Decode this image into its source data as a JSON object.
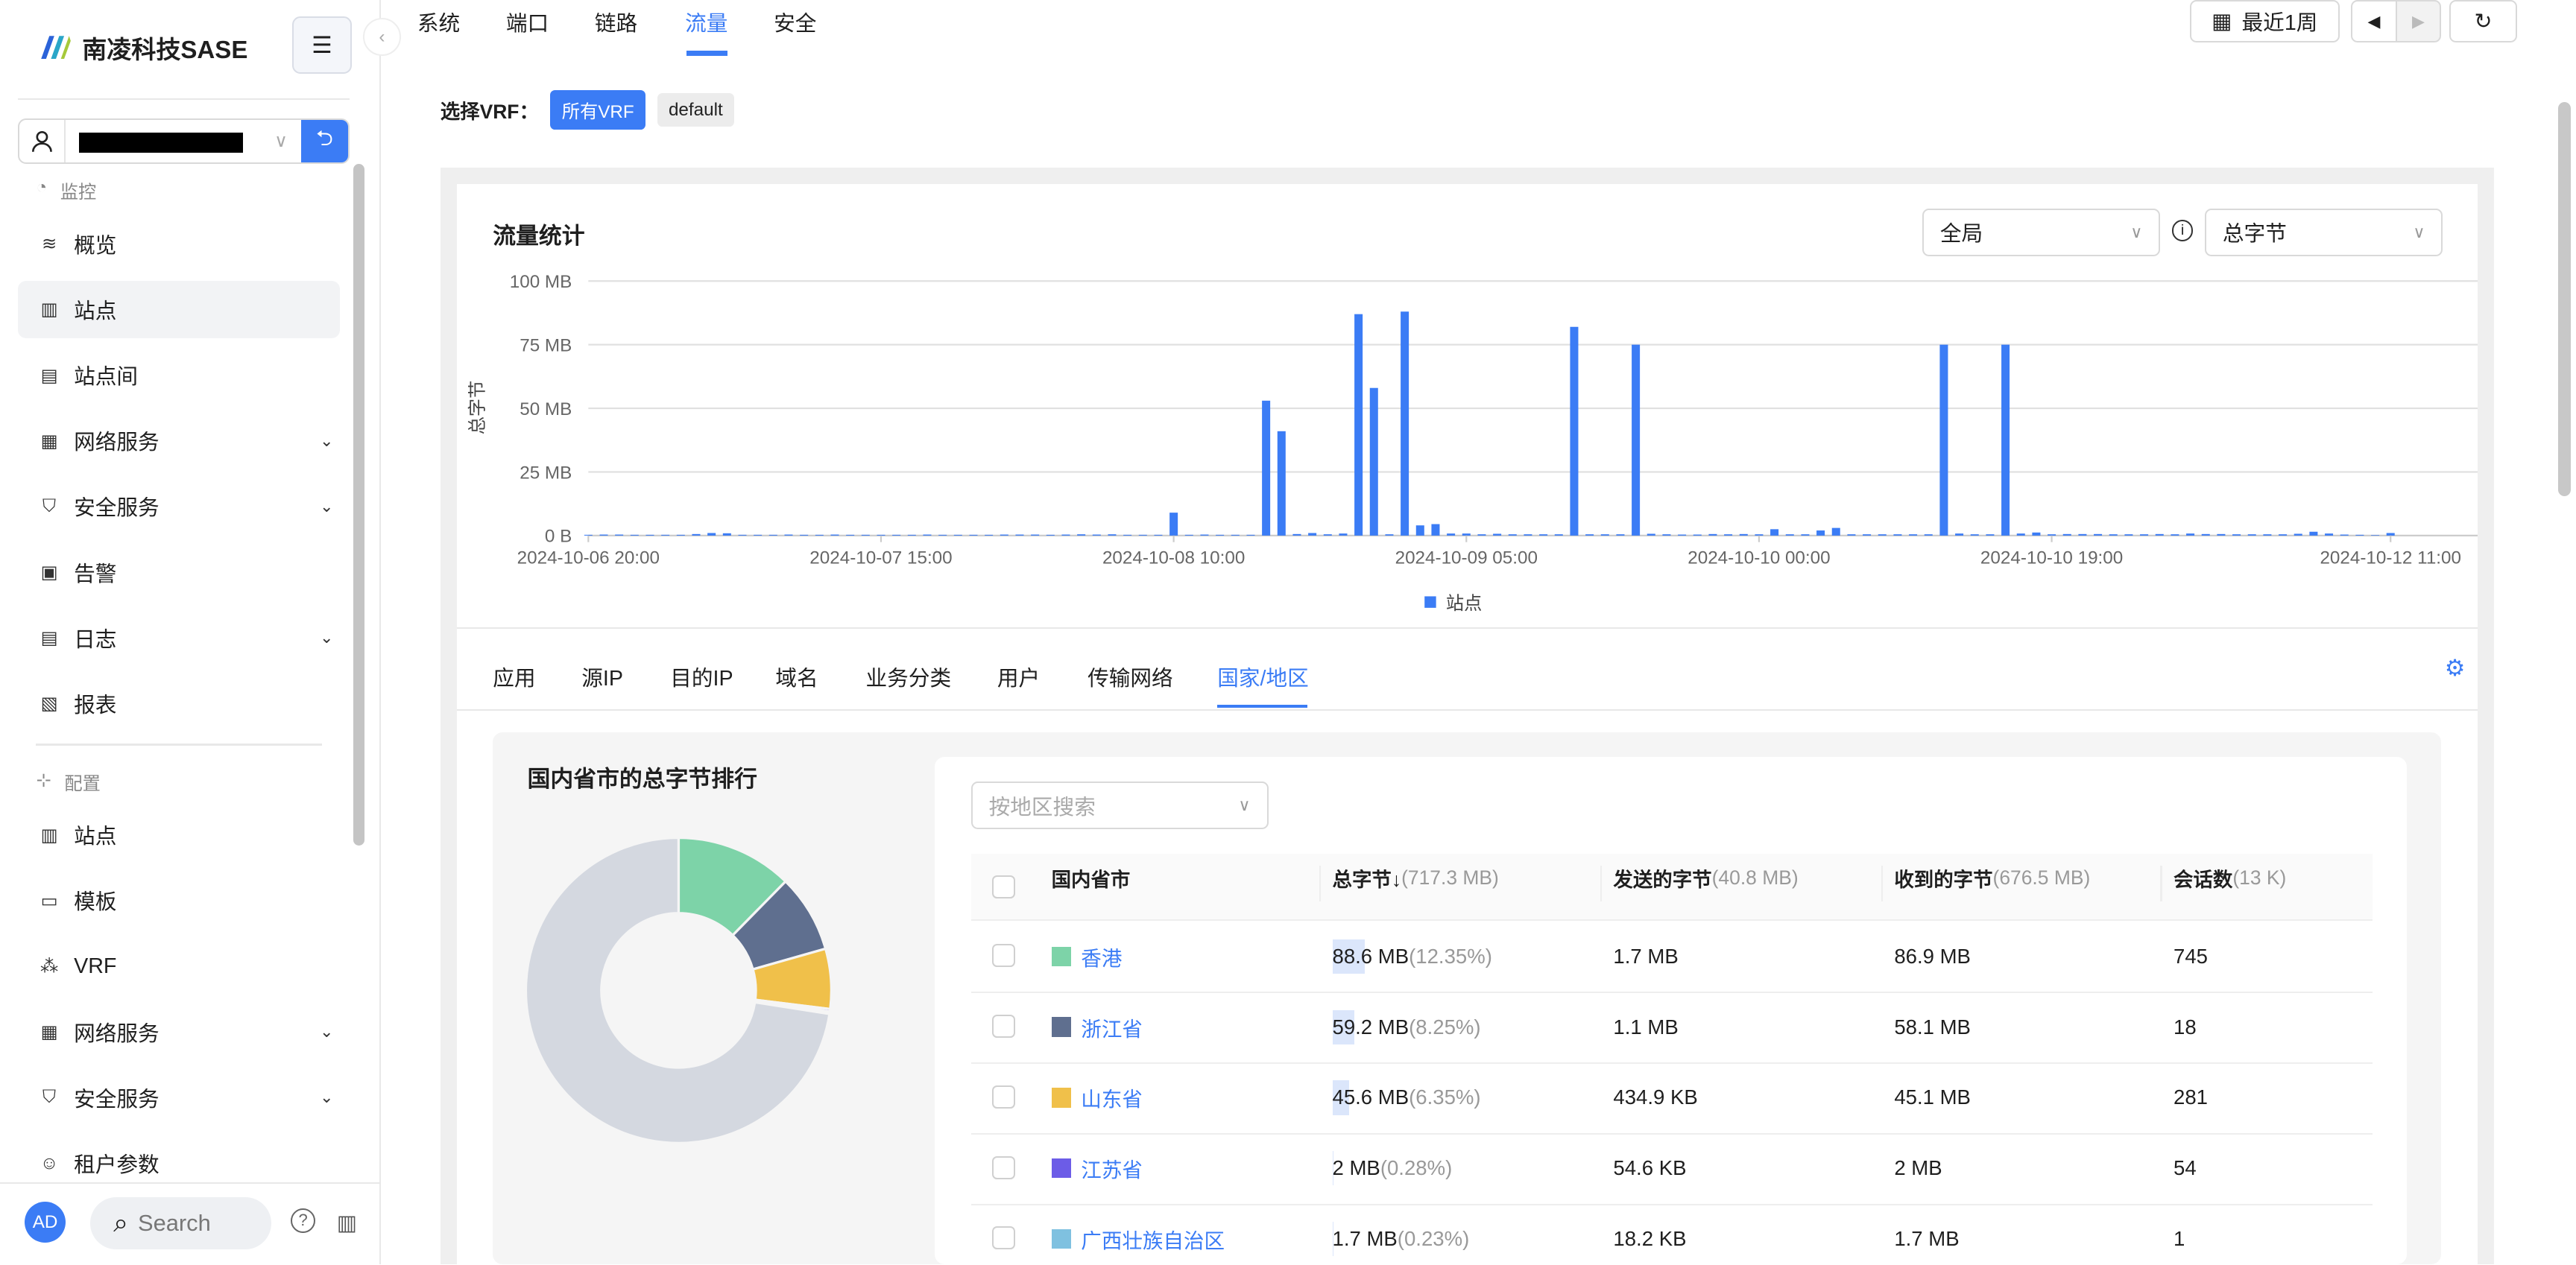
{
  "brand": {
    "name": "南凌科技SASE"
  },
  "sidebar": {
    "user_value": "",
    "sections": [
      {
        "label": "监控"
      },
      {
        "label": "配置"
      }
    ],
    "monitor_items": [
      {
        "label": "概览",
        "icon": "wave-icon"
      },
      {
        "label": "站点",
        "icon": "building-icon",
        "selected": true
      },
      {
        "label": "站点间",
        "icon": "sites-icon"
      },
      {
        "label": "网络服务",
        "icon": "network-icon",
        "expandable": true
      },
      {
        "label": "安全服务",
        "icon": "shield-icon",
        "expandable": true
      },
      {
        "label": "告警",
        "icon": "alert-icon"
      },
      {
        "label": "日志",
        "icon": "log-icon",
        "expandable": true
      },
      {
        "label": "报表",
        "icon": "report-icon"
      }
    ],
    "config_items": [
      {
        "label": "站点",
        "icon": "building-icon"
      },
      {
        "label": "模板",
        "icon": "template-icon"
      },
      {
        "label": "VRF",
        "icon": "vrf-icon"
      },
      {
        "label": "网络服务",
        "icon": "network-icon",
        "expandable": true
      },
      {
        "label": "安全服务",
        "icon": "shield-icon",
        "expandable": true
      },
      {
        "label": "租户参数",
        "icon": "tenant-icon"
      }
    ],
    "avatar": "AD",
    "search_placeholder": "Search"
  },
  "top_tabs": [
    {
      "label": "系统"
    },
    {
      "label": "端口"
    },
    {
      "label": "链路"
    },
    {
      "label": "流量",
      "active": true
    },
    {
      "label": "安全"
    }
  ],
  "toolbar": {
    "range_label": "最近1周"
  },
  "vrf": {
    "label": "选择VRF：",
    "options": [
      {
        "label": "所有VRF",
        "active": true
      },
      {
        "label": "default"
      }
    ]
  },
  "chart_panel": {
    "title": "流量统计",
    "scope_select": "全局",
    "metric_select": "总字节"
  },
  "chart_data": {
    "type": "bar",
    "ylabel": "总字节",
    "ylim": [
      0,
      100
    ],
    "y_unit": "MB",
    "y_ticks": [
      "0 B",
      "25 MB",
      "50 MB",
      "75 MB",
      "100 MB"
    ],
    "x_ticks": [
      {
        "label": "2024-10-06 20:00",
        "index": 0
      },
      {
        "label": "2024-10-07 15:00",
        "index": 19
      },
      {
        "label": "2024-10-08 10:00",
        "index": 38
      },
      {
        "label": "2024-10-09 05:00",
        "index": 57
      },
      {
        "label": "2024-10-10 00:00",
        "index": 76
      },
      {
        "label": "2024-10-10 19:00",
        "index": 95
      },
      {
        "label": "2024-10-12 11:00",
        "index": 117
      }
    ],
    "series": [
      {
        "name": "站点",
        "color": "#3b7cf5",
        "values": [
          0.3,
          0.4,
          0.4,
          0.3,
          0.3,
          0.3,
          0.3,
          0.6,
          1.0,
          0.9,
          0.3,
          0.3,
          0.3,
          0.4,
          0.3,
          0.3,
          0.4,
          0.3,
          0.3,
          0.3,
          0.3,
          0.3,
          0.4,
          0.3,
          0.3,
          0.3,
          0.3,
          0.4,
          0.4,
          0.4,
          0.3,
          0.4,
          0.5,
          0.4,
          0.5,
          0.3,
          0.3,
          0.3,
          9,
          0.3,
          0.4,
          0.3,
          0.3,
          0.3,
          53,
          41,
          0.6,
          1,
          0.5,
          0.8,
          87,
          58,
          0.5,
          88,
          4,
          4.5,
          0.8,
          0.8,
          0.5,
          0.7,
          0.5,
          0.5,
          0.5,
          0.5,
          82,
          0.5,
          0.5,
          0.5,
          75,
          0.7,
          0.5,
          0.4,
          0.4,
          0.6,
          0.5,
          0.6,
          0.5,
          2.5,
          0.5,
          0.5,
          2,
          3,
          0.5,
          0.5,
          0.5,
          0.5,
          0.5,
          0.5,
          75,
          0.8,
          0.5,
          0.5,
          75,
          0.8,
          1.2,
          0.5,
          0.6,
          0.6,
          0.6,
          0.5,
          0.5,
          0.5,
          0.6,
          0.5,
          0.8,
          0.6,
          0.6,
          0.5,
          0.5,
          0.5,
          0.5,
          0.7,
          1.5,
          0.8,
          0.4,
          0.3,
          0.2,
          1.0
        ]
      }
    ],
    "legend": "bottom",
    "grid": true
  },
  "sub_tabs": [
    {
      "label": "应用"
    },
    {
      "label": "源IP"
    },
    {
      "label": "目的IP"
    },
    {
      "label": "域名"
    },
    {
      "label": "业务分类"
    },
    {
      "label": "用户"
    },
    {
      "label": "传输网络"
    },
    {
      "label": "国家/地区",
      "active": true
    }
  ],
  "region": {
    "donut_title": "国内省市的总字节排行",
    "search_placeholder": "按地区搜索",
    "other_color": "#d4d8e0",
    "headers": [
      {
        "label": "国内省市",
        "meta": ""
      },
      {
        "label": "总字节↓",
        "meta": "(717.3 MB)"
      },
      {
        "label": "发送的字节",
        "meta": "(40.8 MB)"
      },
      {
        "label": "收到的字节",
        "meta": "(676.5 MB)"
      },
      {
        "label": "会话数",
        "meta": "(13 K)"
      }
    ],
    "rows": [
      {
        "name": "香港",
        "color": "#7dd3a8",
        "total": "88.6 MB",
        "pct": "(12.35%)",
        "share": 12.35,
        "sent": "1.7 MB",
        "received": "86.9 MB",
        "sessions": "745"
      },
      {
        "name": "浙江省",
        "color": "#5f6f8f",
        "total": "59.2 MB",
        "pct": "(8.25%)",
        "share": 8.25,
        "sent": "1.1 MB",
        "received": "58.1 MB",
        "sessions": "18"
      },
      {
        "name": "山东省",
        "color": "#f0c04a",
        "total": "45.6 MB",
        "pct": "(6.35%)",
        "share": 6.35,
        "sent": "434.9 KB",
        "received": "45.1 MB",
        "sessions": "281"
      },
      {
        "name": "江苏省",
        "color": "#6c5ce7",
        "total": "2 MB",
        "pct": "(0.28%)",
        "share": 0.28,
        "sent": "54.6 KB",
        "received": "2 MB",
        "sessions": "54"
      },
      {
        "name": "广西壮族自治区",
        "color": "#7fc1e0",
        "total": "1.7 MB",
        "pct": "(0.23%)",
        "share": 0.23,
        "sent": "18.2 KB",
        "received": "1.7 MB",
        "sessions": "1"
      }
    ]
  }
}
